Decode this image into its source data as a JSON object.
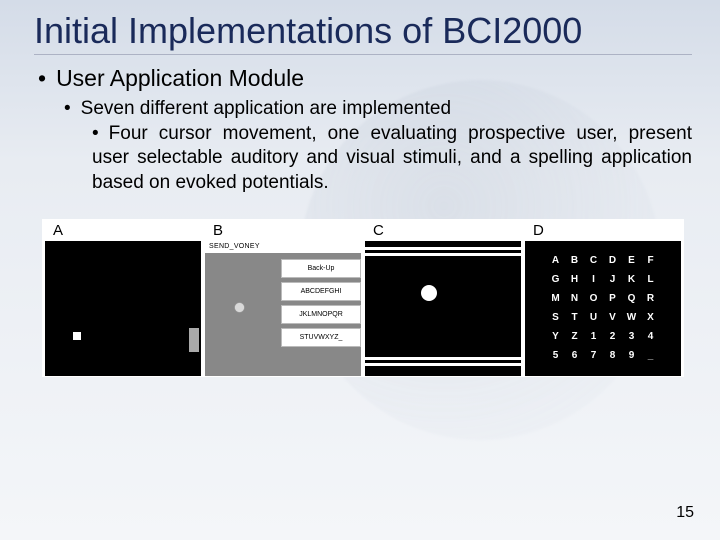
{
  "title": "Initial Implementations of BCI2000",
  "lvl1": "User Application Module",
  "lvl2": "Seven different application are implemented",
  "lvl3": "Four cursor movement, one evaluating prospective user, present user selectable auditory and visual stimuli, and a spelling application based on evoked potentials.",
  "figure": {
    "panels": {
      "a": {
        "label": "A"
      },
      "b": {
        "label": "B",
        "header": "SEND_VONEY",
        "options": [
          "Back-Up",
          "ABCDEFGHI",
          "JKLMNOPQR",
          "STUVWXYZ_"
        ]
      },
      "c": {
        "label": "C"
      },
      "d": {
        "label": "D",
        "grid": [
          "A",
          "B",
          "C",
          "D",
          "E",
          "F",
          "G",
          "H",
          "I",
          "J",
          "K",
          "L",
          "M",
          "N",
          "O",
          "P",
          "Q",
          "R",
          "S",
          "T",
          "U",
          "V",
          "W",
          "X",
          "Y",
          "Z",
          "1",
          "2",
          "3",
          "4",
          "5",
          "6",
          "7",
          "8",
          "9",
          "_"
        ]
      }
    }
  },
  "page_number": "15"
}
